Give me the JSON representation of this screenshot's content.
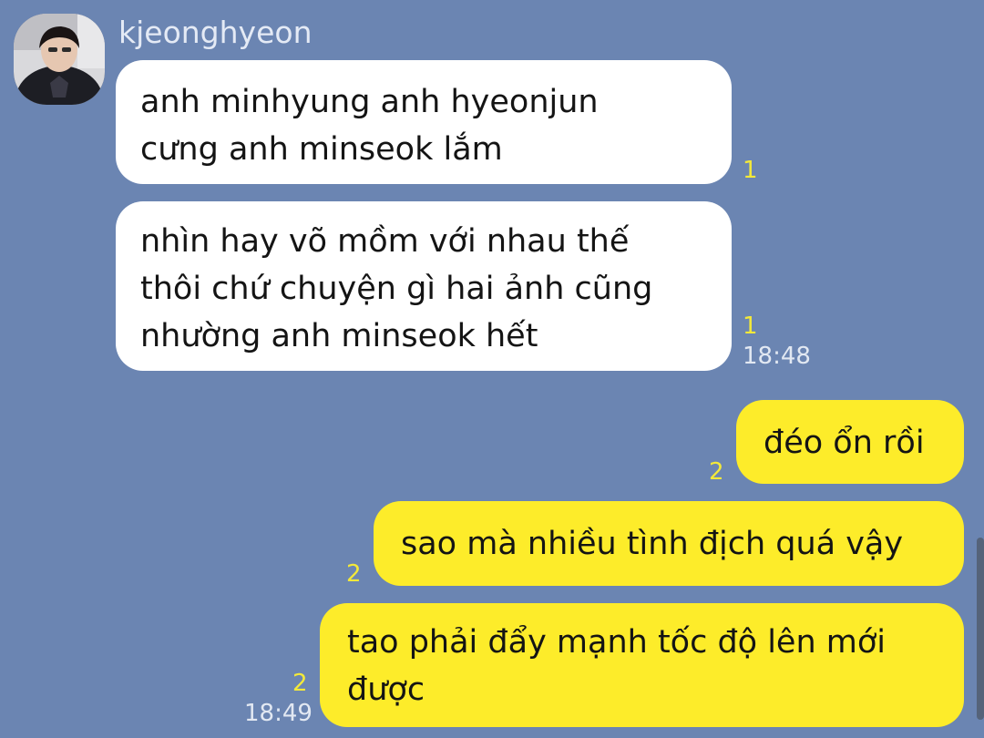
{
  "chat": {
    "sender_name": "kjeonghyeon",
    "incoming": [
      {
        "lines": [
          "anh minhyung anh hyeonjun",
          "cưng anh minseok lắm"
        ],
        "read_count": "1"
      },
      {
        "lines": [
          "nhìn hay võ mồm với nhau thế",
          "thôi chứ chuyện gì hai ảnh cũng",
          "nhường anh minseok hết"
        ],
        "read_count": "1",
        "time": "18:48"
      }
    ],
    "outgoing": [
      {
        "lines": [
          "đéo ổn rồi"
        ],
        "read_count": "2"
      },
      {
        "lines": [
          "sao mà nhiều tình địch quá vậy"
        ],
        "read_count": "2"
      },
      {
        "lines": [
          "tao phải đẩy mạnh tốc độ lên mới",
          "được"
        ],
        "read_count": "2",
        "time": "18:49"
      }
    ]
  },
  "colors": {
    "background": "#6b85b2",
    "incoming_bubble": "#ffffff",
    "outgoing_bubble": "#fdec2a",
    "read_count": "#f3e93a"
  }
}
